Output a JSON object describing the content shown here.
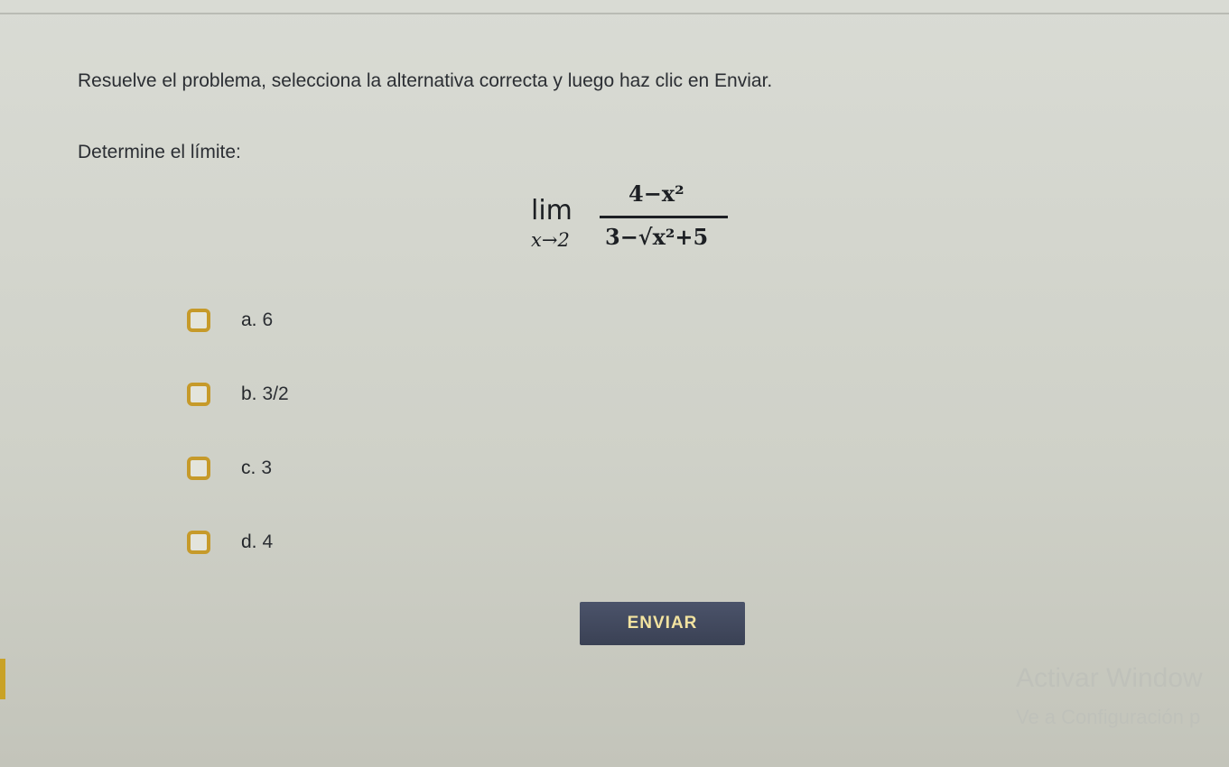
{
  "instruction": "Resuelve el problema, selecciona la alternativa correcta y luego haz clic en Enviar.",
  "question": {
    "label": "Determine el límite:",
    "formula": {
      "lim": "lim",
      "subscript": "x→2",
      "numerator": "4−x²",
      "denominator": "3−√x²+5"
    }
  },
  "options": [
    {
      "letter": "a.",
      "value": "6"
    },
    {
      "letter": "b.",
      "value": "3/2"
    },
    {
      "letter": "c.",
      "value": "3"
    },
    {
      "letter": "d.",
      "value": "4"
    }
  ],
  "submit_label": "ENVIAR",
  "watermark": {
    "title": "Activar Window",
    "subtitle": "Ve a Configuración p"
  },
  "colors": {
    "checkbox_border": "#c69a2a",
    "button_bg": "#3f465b",
    "button_text": "#f2e3a0"
  }
}
